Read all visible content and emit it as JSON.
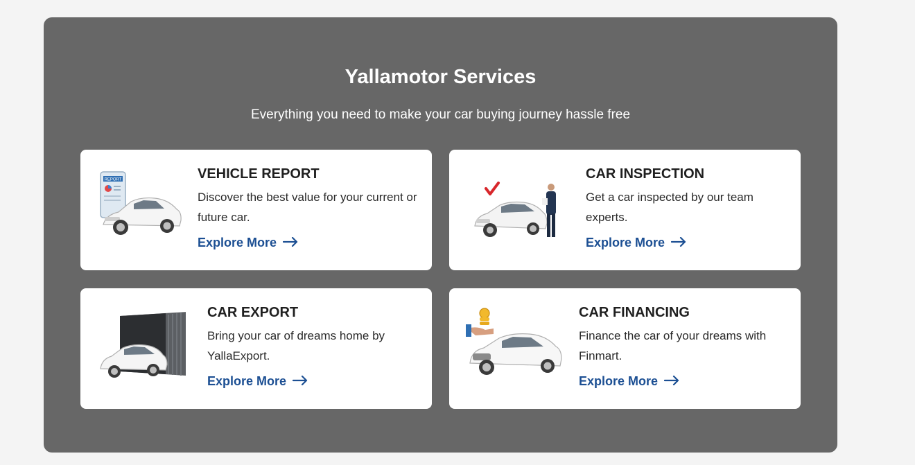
{
  "panel": {
    "title": "Yallamotor Services",
    "subtitle": "Everything you need to make your car buying journey hassle free"
  },
  "services": [
    {
      "title": "VEHICLE REPORT",
      "description": "Discover the best value for your current or future car.",
      "link_label": "Explore More",
      "icon": "vehicle-report-icon",
      "badge_text": "REPORT"
    },
    {
      "title": "CAR INSPECTION",
      "description": "Get a car inspected by our team experts.",
      "link_label": "Explore More",
      "icon": "car-inspection-icon"
    },
    {
      "title": "CAR EXPORT",
      "description": "Bring your car of dreams home by YallaExport.",
      "link_label": "Explore More",
      "icon": "car-export-icon"
    },
    {
      "title": "CAR FINANCING",
      "description": "Finance the car of your dreams with Finmart.",
      "link_label": "Explore More",
      "icon": "car-financing-icon"
    }
  ],
  "colors": {
    "panel_bg": "#676767",
    "card_bg": "#ffffff",
    "link": "#1c4f93",
    "page_bg": "#f4f4f4"
  }
}
